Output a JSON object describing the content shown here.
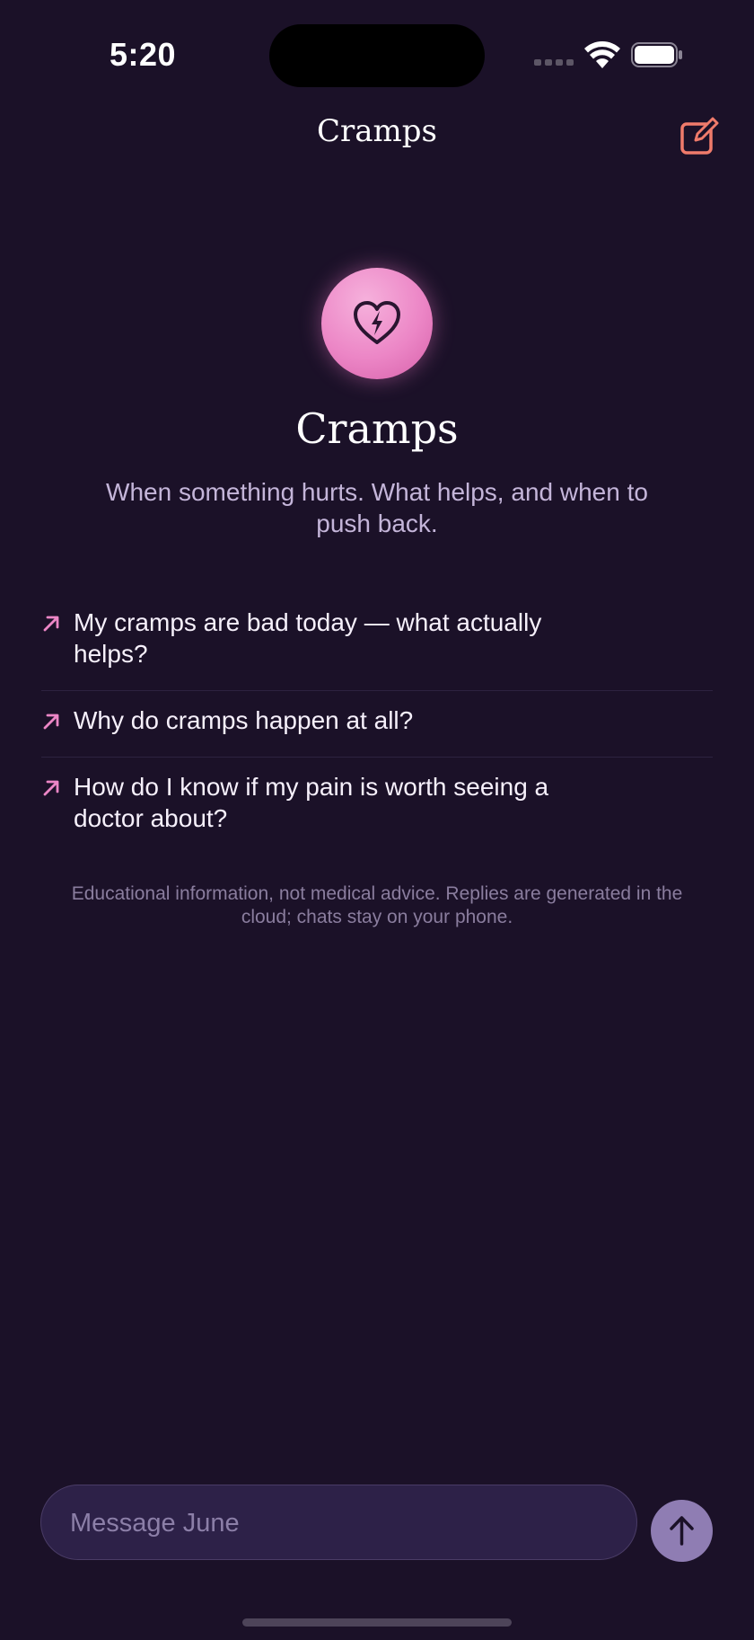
{
  "status_bar": {
    "time": "5:20"
  },
  "nav": {
    "title": "Cramps",
    "compose_icon": "compose-icon"
  },
  "hero": {
    "icon": "heart-bolt-icon",
    "title": "Cramps",
    "subtitle": "When something hurts. What helps, and when to push back."
  },
  "suggestions": [
    {
      "text": "My cramps are bad today — what actually helps?"
    },
    {
      "text": "Why do cramps happen at all?"
    },
    {
      "text": "How do I know if my pain is worth seeing a doctor about?"
    }
  ],
  "disclaimer": "Educational information, not medical advice. Replies are generated in the cloud; chats stay on your phone.",
  "composer": {
    "placeholder": "Message June",
    "send_icon": "arrow-up-icon"
  },
  "colors": {
    "background": "#1b1128",
    "accent_pink": "#ec86c6",
    "compose_orange": "#f07b6b",
    "send_button": "#8f7db3"
  }
}
